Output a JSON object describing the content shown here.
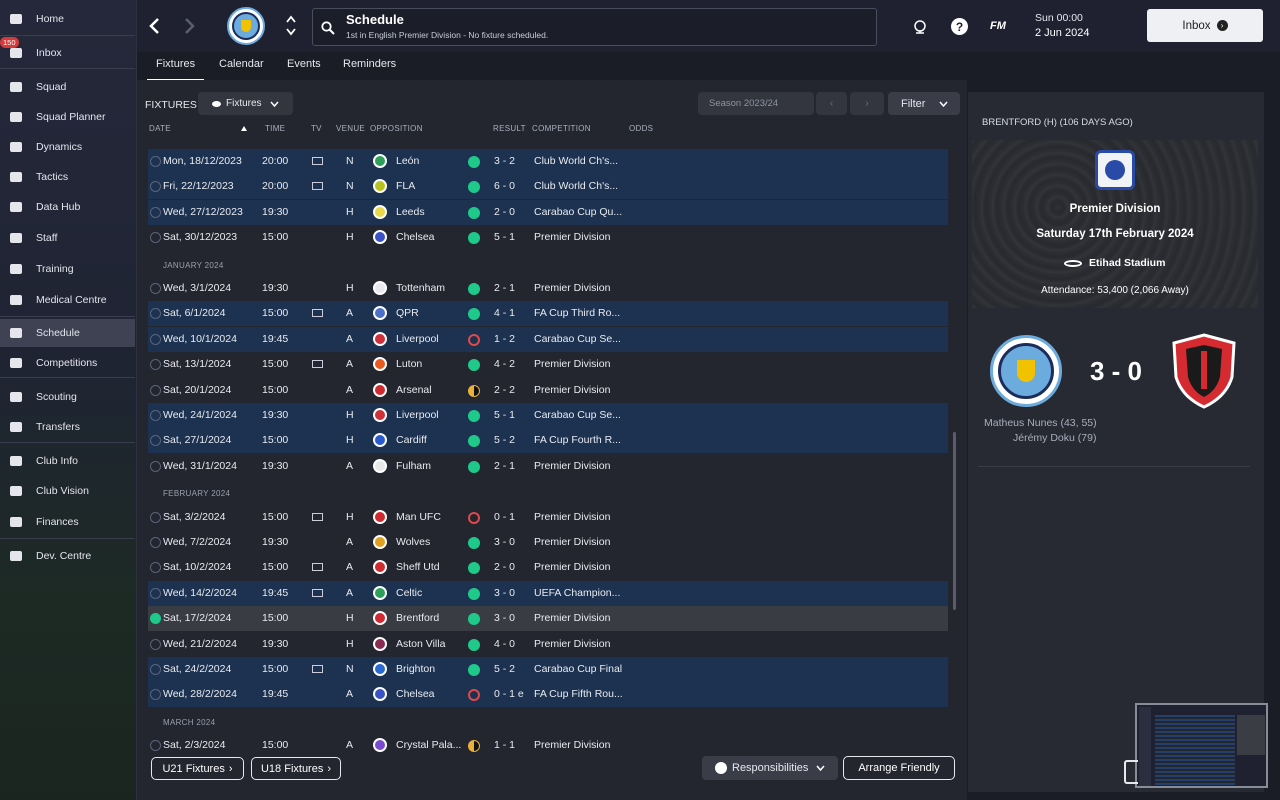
{
  "sidebar": {
    "items": [
      {
        "label": "Home",
        "icon": "home-icon"
      },
      {
        "label": "Inbox",
        "icon": "inbox-icon",
        "badge": "150"
      },
      {
        "label": "Squad",
        "icon": "squad-icon"
      },
      {
        "label": "Squad Planner",
        "icon": "clipboard-icon"
      },
      {
        "label": "Dynamics",
        "icon": "dynamics-icon"
      },
      {
        "label": "Tactics",
        "icon": "tactics-icon"
      },
      {
        "label": "Data Hub",
        "icon": "data-hub-icon"
      },
      {
        "label": "Staff",
        "icon": "staff-icon"
      },
      {
        "label": "Training",
        "icon": "training-icon"
      },
      {
        "label": "Medical Centre",
        "icon": "medical-icon"
      },
      {
        "label": "Schedule",
        "icon": "calendar-icon"
      },
      {
        "label": "Competitions",
        "icon": "trophy-icon"
      },
      {
        "label": "Scouting",
        "icon": "search-icon"
      },
      {
        "label": "Transfers",
        "icon": "transfers-icon"
      },
      {
        "label": "Club Info",
        "icon": "shield-icon"
      },
      {
        "label": "Club Vision",
        "icon": "briefcase-icon"
      },
      {
        "label": "Finances",
        "icon": "finances-icon"
      },
      {
        "label": "Dev. Centre",
        "icon": "dev-centre-icon"
      }
    ]
  },
  "header": {
    "title": "Schedule",
    "subtitle": "1st in English Premier Division - No fixture scheduled.",
    "fm": "FM",
    "time": "Sun 00:00",
    "date": "2 Jun 2024",
    "inbox_button": "Inbox",
    "club_crest_text": "MANCHESTER CITY"
  },
  "tabs": [
    "Fixtures",
    "Calendar",
    "Events",
    "Reminders"
  ],
  "toolbar": {
    "fixtures_label": "FIXTURES",
    "fixtures_dropdown": "Fixtures",
    "season": "Season 2023/24",
    "filter": "Filter"
  },
  "columns": [
    "DATE",
    "TIME",
    "TV",
    "VENUE",
    "OPPOSITION",
    "RESULT",
    "COMPETITION",
    "ODDS"
  ],
  "rows": [
    {
      "type": "match",
      "date": "Mon, 18/12/2023",
      "time": "20:00",
      "tv": true,
      "venue": "N",
      "opp": "León",
      "res": "win",
      "score": "3 - 2",
      "comp": "Club World Ch's...",
      "hl": true,
      "crest": "#2ea05b"
    },
    {
      "type": "match",
      "date": "Fri, 22/12/2023",
      "time": "20:00",
      "tv": true,
      "venue": "N",
      "opp": "FLA",
      "res": "win",
      "score": "6 - 0",
      "comp": "Club World Ch's...",
      "hl": true,
      "crest": "#b8c21f"
    },
    {
      "type": "match",
      "date": "Wed, 27/12/2023",
      "time": "19:30",
      "tv": false,
      "venue": "H",
      "opp": "Leeds",
      "res": "win",
      "score": "2 - 0",
      "comp": "Carabao Cup Qu...",
      "hl": true,
      "crest": "#e8d84a"
    },
    {
      "type": "match",
      "date": "Sat, 30/12/2023",
      "time": "15:00",
      "tv": false,
      "venue": "H",
      "opp": "Chelsea",
      "res": "win",
      "score": "5 - 1",
      "comp": "Premier Division",
      "hl": false,
      "crest": "#3a52c8"
    },
    {
      "type": "month",
      "label": "JANUARY 2024"
    },
    {
      "type": "match",
      "date": "Wed, 3/1/2024",
      "time": "19:30",
      "tv": false,
      "venue": "H",
      "opp": "Tottenham",
      "res": "win",
      "score": "2 - 1",
      "comp": "Premier Division",
      "hl": false,
      "crest": "#e8e8f0"
    },
    {
      "type": "match",
      "date": "Sat, 6/1/2024",
      "time": "15:00",
      "tv": true,
      "venue": "A",
      "opp": "QPR",
      "res": "win",
      "score": "4 - 1",
      "comp": "FA Cup Third Ro...",
      "hl": true,
      "crest": "#4a70c8"
    },
    {
      "type": "match",
      "date": "Wed, 10/1/2024",
      "time": "19:45",
      "tv": false,
      "venue": "A",
      "opp": "Liverpool",
      "res": "loss",
      "score": "1 - 2",
      "comp": "Carabao Cup Se...",
      "hl": true,
      "crest": "#d0303a"
    },
    {
      "type": "match",
      "date": "Sat, 13/1/2024",
      "time": "15:00",
      "tv": true,
      "venue": "A",
      "opp": "Luton",
      "res": "win",
      "score": "4 - 2",
      "comp": "Premier Division",
      "hl": false,
      "crest": "#e85a20"
    },
    {
      "type": "match",
      "date": "Sat, 20/1/2024",
      "time": "15:00",
      "tv": false,
      "venue": "A",
      "opp": "Arsenal",
      "res": "draw",
      "score": "2 - 2",
      "comp": "Premier Division",
      "hl": false,
      "crest": "#d02a30"
    },
    {
      "type": "match",
      "date": "Wed, 24/1/2024",
      "time": "19:30",
      "tv": false,
      "venue": "H",
      "opp": "Liverpool",
      "res": "win",
      "score": "5 - 1",
      "comp": "Carabao Cup Se...",
      "hl": true,
      "crest": "#d0303a"
    },
    {
      "type": "match",
      "date": "Sat, 27/1/2024",
      "time": "15:00",
      "tv": false,
      "venue": "H",
      "opp": "Cardiff",
      "res": "win",
      "score": "5 - 2",
      "comp": "FA Cup Fourth R...",
      "hl": true,
      "crest": "#2a5ad0"
    },
    {
      "type": "match",
      "date": "Wed, 31/1/2024",
      "time": "19:30",
      "tv": false,
      "venue": "A",
      "opp": "Fulham",
      "res": "win",
      "score": "2 - 1",
      "comp": "Premier Division",
      "hl": false,
      "crest": "#e8e8e8"
    },
    {
      "type": "month",
      "label": "FEBRUARY 2024"
    },
    {
      "type": "match",
      "date": "Sat, 3/2/2024",
      "time": "15:00",
      "tv": true,
      "venue": "H",
      "opp": "Man UFC",
      "res": "loss",
      "score": "0 - 1",
      "comp": "Premier Division",
      "hl": false,
      "crest": "#d02a30"
    },
    {
      "type": "match",
      "date": "Wed, 7/2/2024",
      "time": "19:30",
      "tv": false,
      "venue": "A",
      "opp": "Wolves",
      "res": "win",
      "score": "3 - 0",
      "comp": "Premier Division",
      "hl": false,
      "crest": "#e0a020"
    },
    {
      "type": "match",
      "date": "Sat, 10/2/2024",
      "time": "15:00",
      "tv": true,
      "venue": "A",
      "opp": "Sheff Utd",
      "res": "win",
      "score": "2 - 0",
      "comp": "Premier Division",
      "hl": false,
      "crest": "#d02a30"
    },
    {
      "type": "match",
      "date": "Wed, 14/2/2024",
      "time": "19:45",
      "tv": true,
      "venue": "A",
      "opp": "Celtic",
      "res": "win",
      "score": "3 - 0",
      "comp": "UEFA Champion...",
      "hl": true,
      "crest": "#2ea05b"
    },
    {
      "type": "match",
      "date": "Sat, 17/2/2024",
      "time": "15:00",
      "tv": false,
      "venue": "H",
      "opp": "Brentford",
      "res": "win",
      "score": "3 - 0",
      "comp": "Premier Division",
      "hl": false,
      "sel": true,
      "crest": "#d02a30"
    },
    {
      "type": "match",
      "date": "Wed, 21/2/2024",
      "time": "19:30",
      "tv": false,
      "venue": "H",
      "opp": "Aston Villa",
      "res": "win",
      "score": "4 - 0",
      "comp": "Premier Division",
      "hl": false,
      "crest": "#8a2a50"
    },
    {
      "type": "match",
      "date": "Sat, 24/2/2024",
      "time": "15:00",
      "tv": true,
      "venue": "N",
      "opp": "Brighton",
      "res": "win",
      "score": "5 - 2",
      "comp": "Carabao Cup Final",
      "hl": true,
      "crest": "#2a6ad0"
    },
    {
      "type": "match",
      "date": "Wed, 28/2/2024",
      "time": "19:45",
      "tv": false,
      "venue": "A",
      "opp": "Chelsea",
      "res": "loss",
      "score": "0 - 1 e",
      "comp": "FA Cup Fifth Rou...",
      "hl": true,
      "crest": "#3a52c8"
    },
    {
      "type": "month",
      "label": "MARCH 2024"
    },
    {
      "type": "match",
      "date": "Sat, 2/3/2024",
      "time": "15:00",
      "tv": false,
      "venue": "A",
      "opp": "Crystal Pala...",
      "res": "draw",
      "score": "1 - 1",
      "comp": "Premier Division",
      "hl": false,
      "crest": "#7a4ad0"
    }
  ],
  "footer": {
    "u21": "U21 Fixtures",
    "u18": "U18 Fixtures",
    "responsibilities": "Responsibilities",
    "arrange": "Arrange Friendly"
  },
  "detail": {
    "header": "BRENTFORD (H) (106 DAYS AGO)",
    "competition": "Premier Division",
    "date": "Saturday 17th February 2024",
    "stadium": "Etihad Stadium",
    "attendance": "Attendance: 53,400 (2,066 Away)",
    "score": "3 - 0",
    "scorers": [
      "Matheus Nunes (43, 55)",
      "Jérémy Doku (79)"
    ],
    "home_crest_text": "MANCHESTER CITY"
  },
  "colors": {
    "win": "#1ec98a",
    "loss": "#e0484a",
    "draw": "#e8b23a",
    "highlight": "#1c3250"
  }
}
